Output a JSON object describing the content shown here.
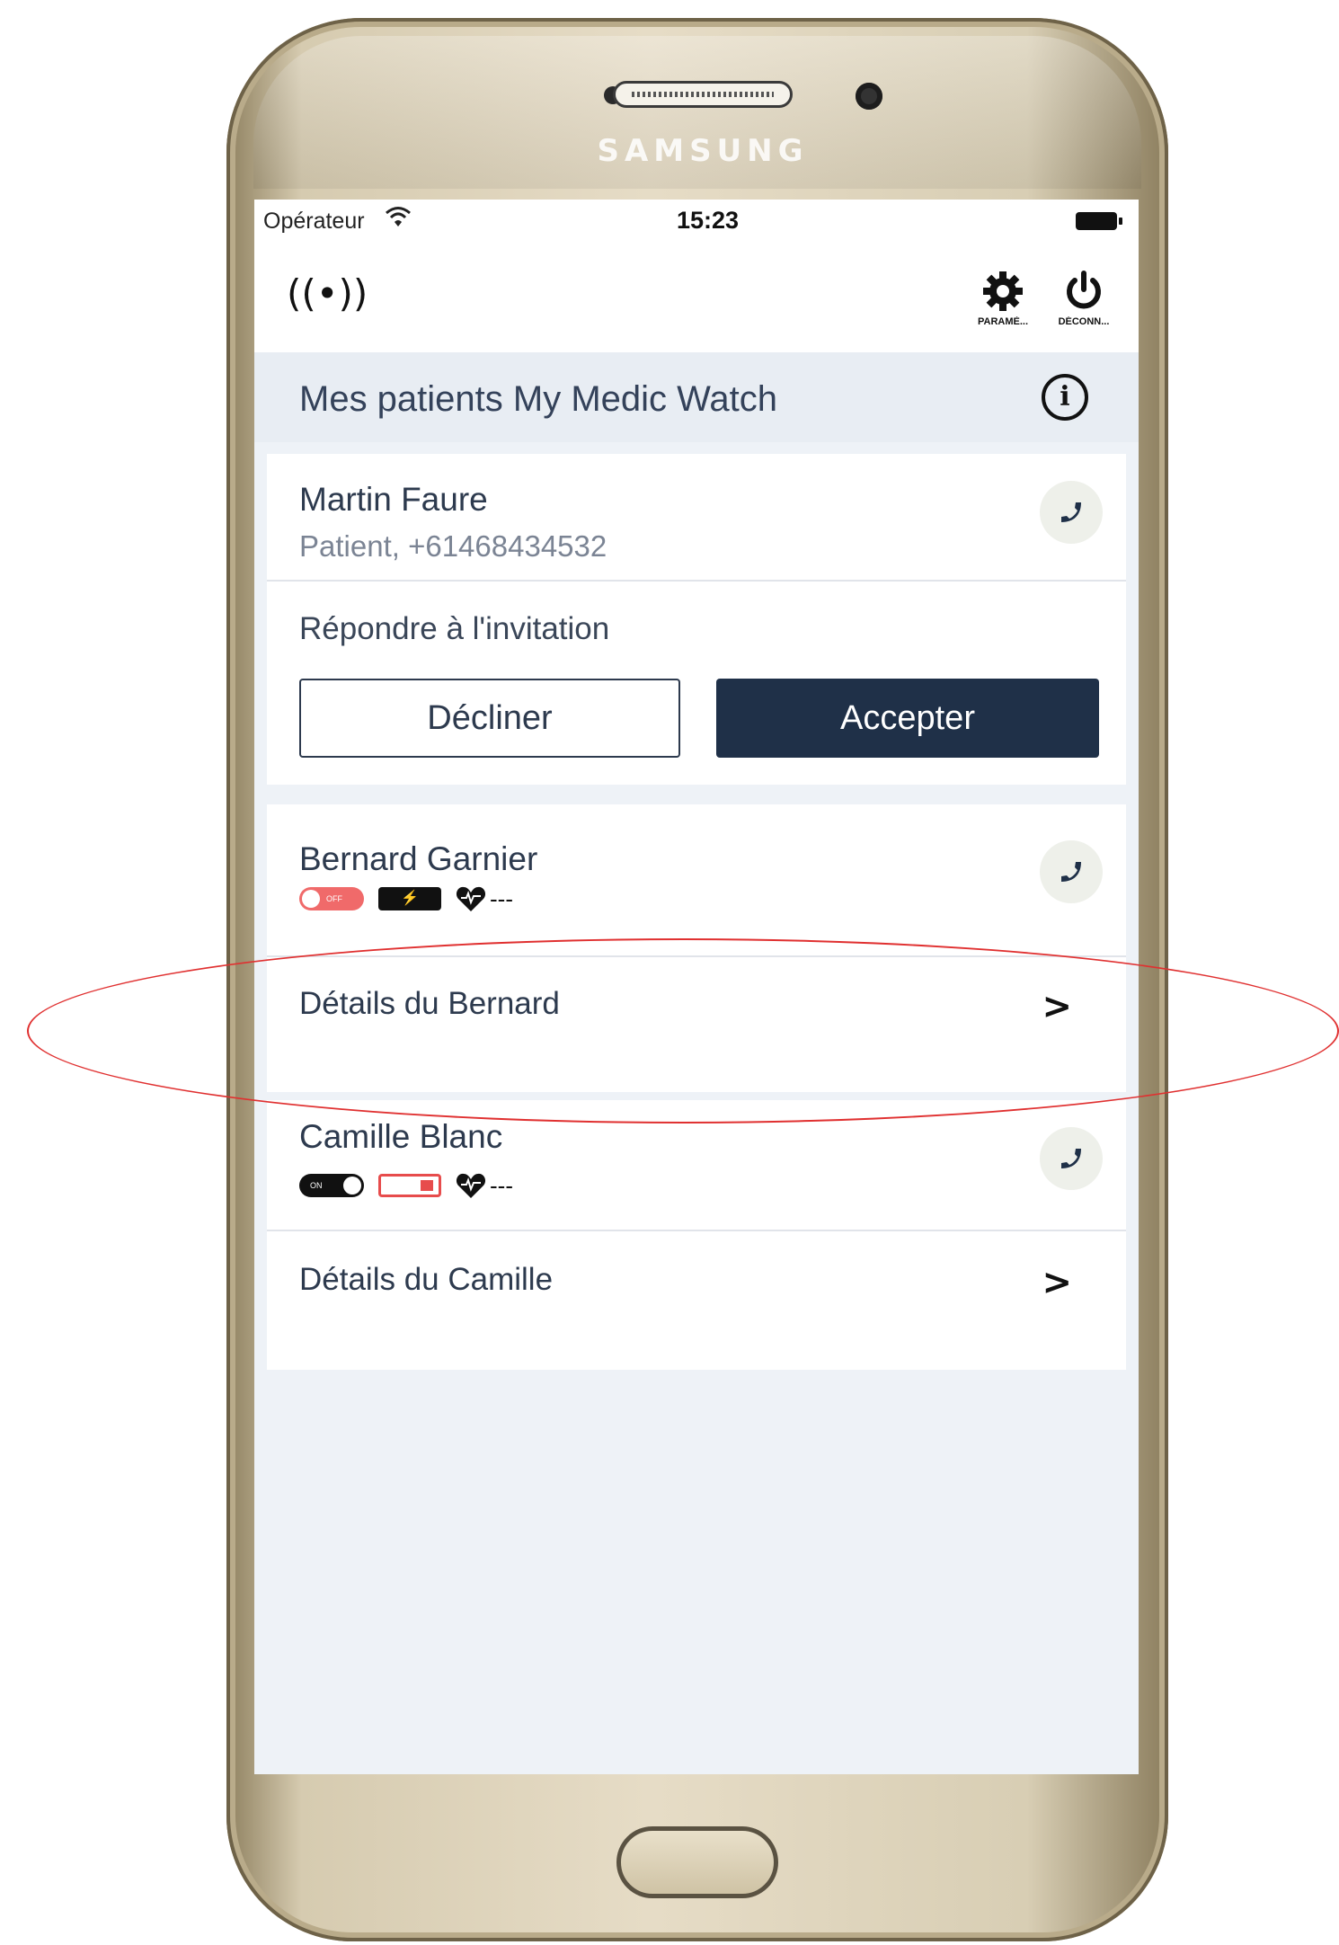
{
  "device": {
    "brand": "SAMSUNG"
  },
  "status_bar": {
    "carrier": "Opérateur",
    "time": "15:23"
  },
  "header": {
    "settings_label": "PARAMÈ...",
    "logout_label": "DÉCONN..."
  },
  "section": {
    "title": "Mes patients My Medic Watch"
  },
  "invitation_card": {
    "name": "Martin Faure",
    "subtitle": "Patient, +61468434532",
    "prompt": "Répondre à l'invitation",
    "decline_label": "Décliner",
    "accept_label": "Accepter"
  },
  "patients": [
    {
      "name": "Bernard Garnier",
      "toggle_label": "OFF",
      "heart_rate": "---",
      "details_label": "Détails du Bernard"
    },
    {
      "name": "Camille Blanc",
      "toggle_label": "ON",
      "heart_rate": "---",
      "details_label": "Détails du Camille"
    }
  ],
  "colors": {
    "primary": "#1f3048",
    "text": "#2d3a4e",
    "off_toggle": "#f06a6a",
    "low_battery": "#e74c4c",
    "annotation": "#e03030"
  }
}
